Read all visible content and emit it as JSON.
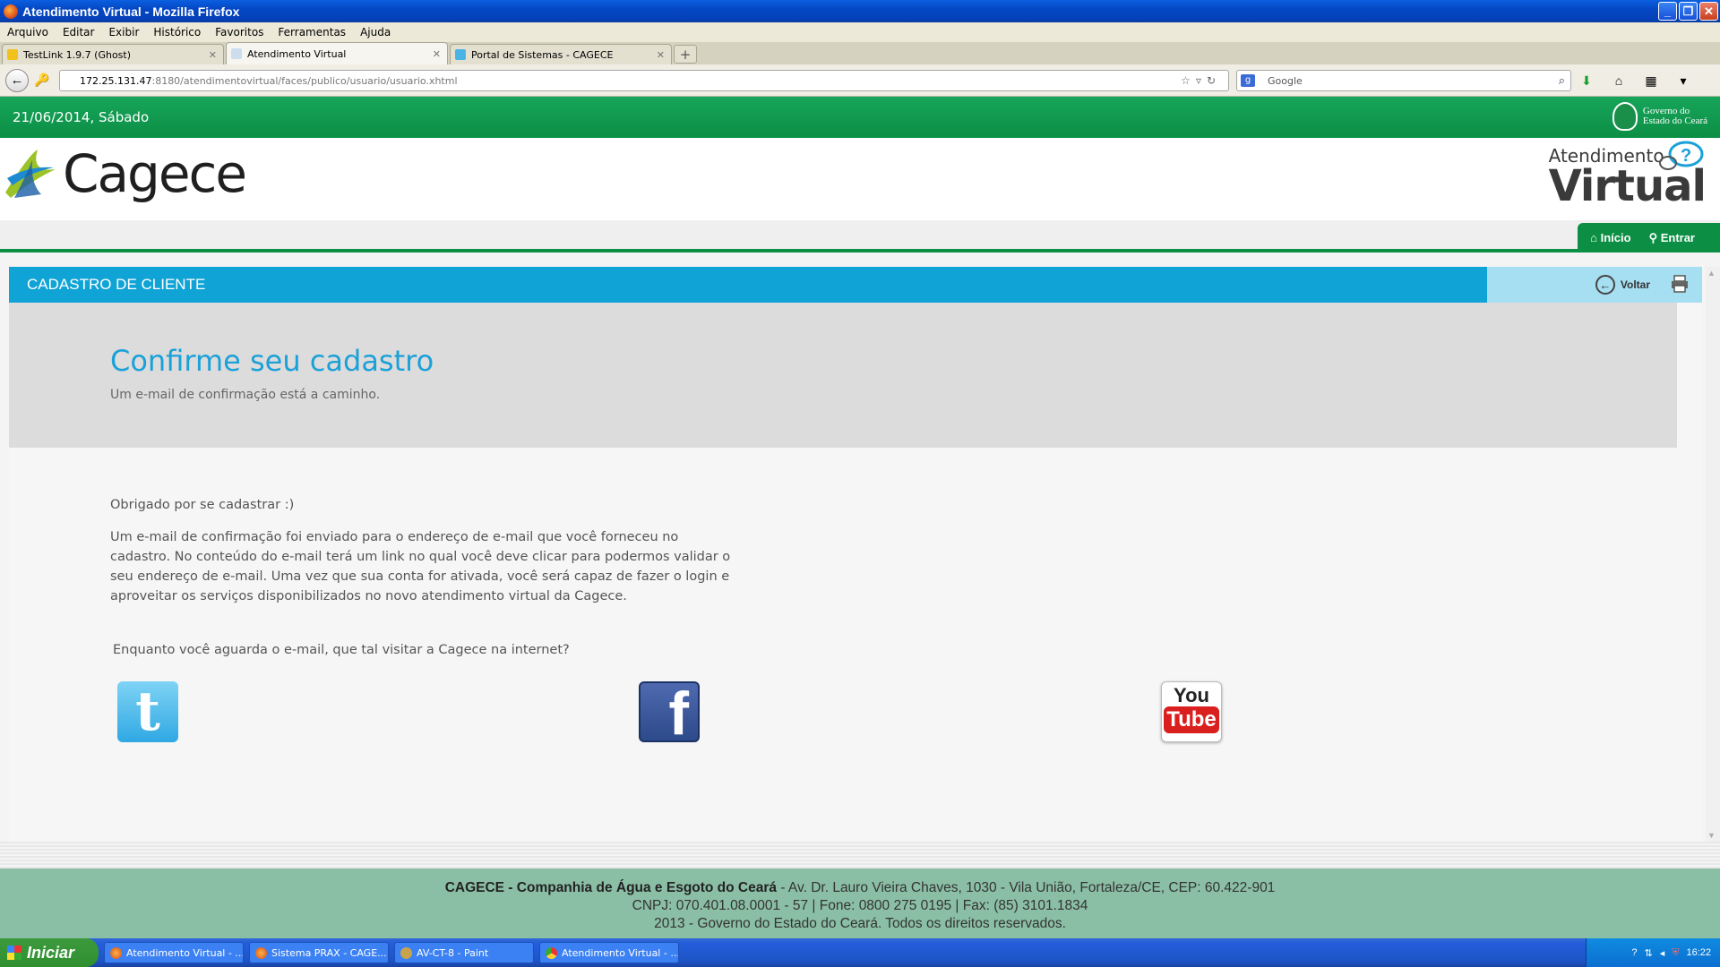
{
  "window": {
    "title": "Atendimento Virtual - Mozilla Firefox",
    "buttons": {
      "minimize": "_",
      "maximize": "❐",
      "close": "✕"
    }
  },
  "menu": [
    "Arquivo",
    "Editar",
    "Exibir",
    "Histórico",
    "Favoritos",
    "Ferramentas",
    "Ajuda"
  ],
  "tabs": [
    {
      "label": "TestLink 1.9.7 (Ghost)",
      "active": false
    },
    {
      "label": "Atendimento Virtual",
      "active": true
    },
    {
      "label": "Portal de Sistemas - CAGECE",
      "active": false
    }
  ],
  "address_bar": {
    "host": "172.25.131.47",
    "path": ":8180/atendimentovirtual/faces/publico/usuario/usuario.xhtml"
  },
  "search_bar": {
    "engine": "Google",
    "placeholder": "Google"
  },
  "page": {
    "date": "21/06/2014, Sábado",
    "gov_logo_line1": "Governo do",
    "gov_logo_line2": "Estado do Ceará",
    "brand": "Cagece",
    "av_logo_line1": "Atendimento",
    "av_logo_line2": "Virtual",
    "nav": {
      "home": "Início",
      "login": "Entrar"
    },
    "section_title": "CADASTRO DE CLIENTE",
    "voltar": "Voltar",
    "heading": "Confirme seu cadastro",
    "subheading": "Um e-mail de confirmação está a caminho.",
    "thanks": "Obrigado por se cadastrar :)",
    "message": "Um e-mail de confirmação foi enviado para o endereço de e-mail que você forneceu no cadastro. No conteúdo do e-mail terá um link no qual você deve clicar para podermos validar o seu endereço de e-mail. Uma vez que sua conta for ativada, você será capaz de fazer o login e aproveitar os serviços disponibilizados no novo atendimento virtual da Cagece.",
    "visit_prompt": "Enquanto você aguarda o e-mail, que tal visitar a Cagece na internet?",
    "social": {
      "twitter_glyph": "t",
      "facebook_glyph": "f",
      "youtube_top": "You",
      "youtube_bottom": "Tube"
    }
  },
  "footer": {
    "company": "CAGECE - Companhia de Água e Esgoto do Ceará",
    "address": " - Av. Dr. Lauro Vieira Chaves, 1030 - Vila União, Fortaleza/CE, CEP: 60.422-901",
    "line2": "CNPJ: 070.401.08.0001 - 57 | Fone: 0800 275 0195 | Fax: (85) 3101.1834",
    "line3": "2013 - Governo do Estado do Ceará. Todos os direitos reservados."
  },
  "taskbar": {
    "start": "Iniciar",
    "items": [
      "Atendimento Virtual - ...",
      "Sistema PRAX - CAGE...",
      "AV-CT-8 - Paint",
      "Atendimento Virtual - ..."
    ],
    "clock": "16:22"
  },
  "colors": {
    "brand_green": "#0c8f45",
    "section_blue": "#10a3d6",
    "heading_blue": "#1ba1d8"
  }
}
